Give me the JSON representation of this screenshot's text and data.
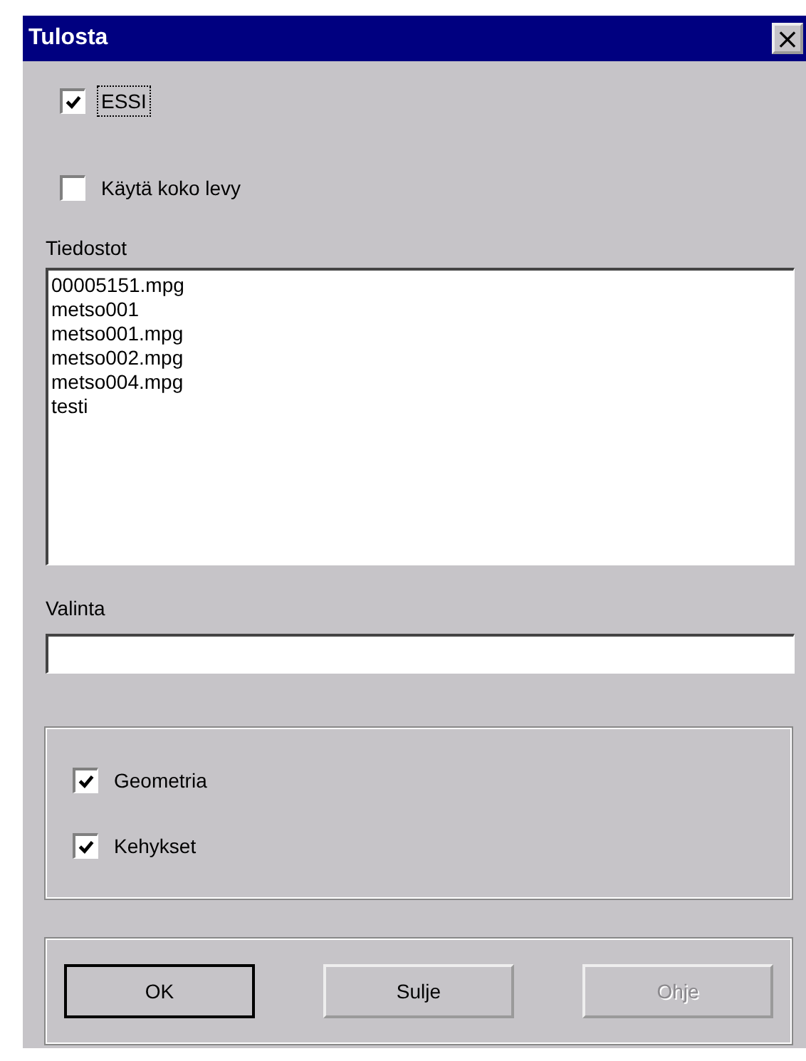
{
  "window": {
    "title": "Tulosta",
    "close": "×"
  },
  "options": [
    {
      "label": "ESSI",
      "checked": true,
      "focused": true
    },
    {
      "label": "Käytä koko levy",
      "checked": false,
      "focused": false
    }
  ],
  "files": {
    "label": "Tiedostot",
    "items": [
      {
        "text": "00005151.mpg",
        "selected": false
      },
      {
        "text": "metso001",
        "selected": false
      },
      {
        "text": "metso001.mpg",
        "selected": false
      },
      {
        "text": "metso002.mpg",
        "selected": false
      },
      {
        "text": "metso004.mpg",
        "selected": false
      },
      {
        "text": "testi",
        "selected": false
      }
    ]
  },
  "selection": {
    "label": "Valinta"
  },
  "content": [
    {
      "label": "Geometria",
      "checked": true
    },
    {
      "label": "Kehykset",
      "checked": true
    }
  ],
  "buttons": [
    {
      "label": "OK",
      "default": true,
      "disabled": false
    },
    {
      "label": "Sulje",
      "default": false,
      "disabled": false
    },
    {
      "label": "Ohje",
      "default": false,
      "disabled": true
    }
  ]
}
